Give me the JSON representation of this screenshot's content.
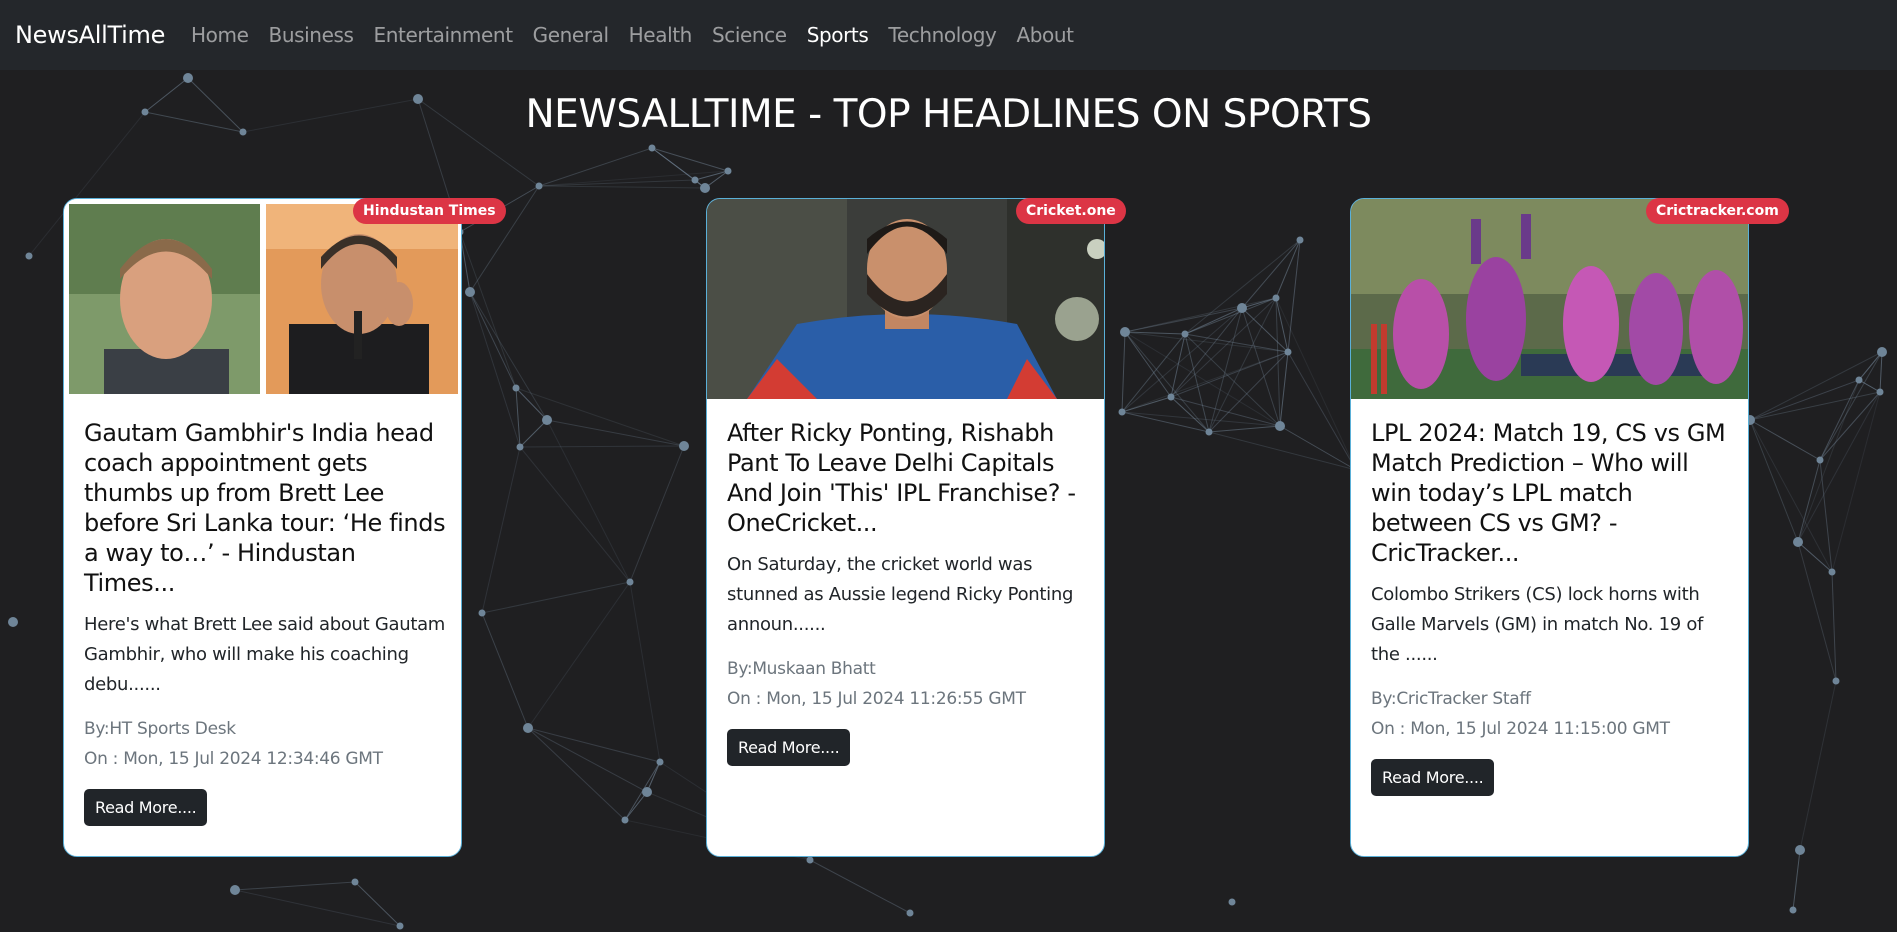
{
  "nav": {
    "brand": "NewsAllTime",
    "links": [
      "Home",
      "Business",
      "Entertainment",
      "General",
      "Health",
      "Science",
      "Sports",
      "Technology",
      "About"
    ],
    "active": "Sports"
  },
  "page_title": "NEWSALLTIME - TOP HEADLINES ON SPORTS",
  "cards": [
    {
      "source": "Hindustan Times",
      "title": "Gautam Gambhir's India head coach appointment gets thumbs up from Brett Lee before Sri Lanka tour: ‘He finds a way to…’ - Hindustan Times...",
      "description": "Here's what Brett Lee said about Gautam Gambhir, who will make his coaching debu......",
      "author": "By:HT Sports Desk",
      "date": "On : Mon, 15 Jul 2024 12:34:46 GMT",
      "button": "Read More...."
    },
    {
      "source": "Cricket.one",
      "title": "After Ricky Ponting, Rishabh Pant To Leave Delhi Capitals And Join 'This' IPL Franchise? - OneCricket...",
      "description": "On Saturday, the cricket world was stunned as Aussie legend Ricky Ponting announ......",
      "author": "By:Muskaan Bhatt",
      "date": "On : Mon, 15 Jul 2024 11:26:55 GMT",
      "button": "Read More...."
    },
    {
      "source": "Crictracker.com",
      "title": "LPL 2024: Match 19, CS vs GM Match Prediction – Who will win today’s LPL match between CS vs GM? - CricTracker...",
      "description": "Colombo Strikers (CS) lock horns with Galle Marvels (GM) in match No. 19 of the ......",
      "author": "By:CricTracker Staff",
      "date": "On : Mon, 15 Jul 2024 11:15:00 GMT",
      "button": "Read More...."
    }
  ]
}
